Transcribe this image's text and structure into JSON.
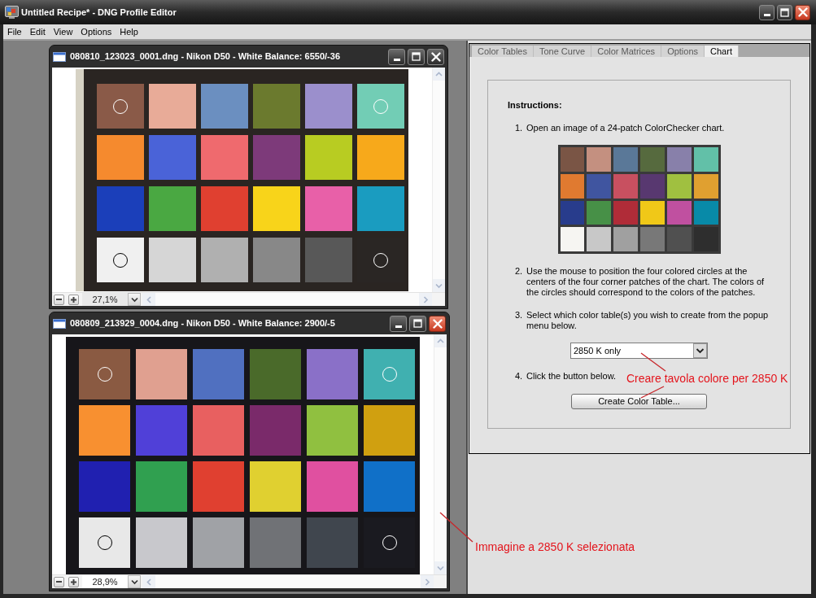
{
  "window": {
    "title": "Untitled Recipe* - DNG Profile Editor"
  },
  "menu": [
    "File",
    "Edit",
    "View",
    "Options",
    "Help"
  ],
  "documents": [
    {
      "title": "080810_123023_0001.dng - Nikon D50 - White Balance: 6550/-36",
      "active": false,
      "zoom": "27,1%"
    },
    {
      "title": "080809_213929_0004.dng - Nikon D50 - White Balance: 2900/-5",
      "active": true,
      "zoom": "28,9%"
    }
  ],
  "tabs": [
    {
      "label": "Color Tables",
      "selected": false
    },
    {
      "label": "Tone Curve",
      "selected": false
    },
    {
      "label": "Color Matrices",
      "selected": false
    },
    {
      "label": "Options",
      "selected": false
    },
    {
      "label": "Chart",
      "selected": true
    }
  ],
  "chart_tab": {
    "heading": "Instructions:",
    "content": [
      {
        "kind": "step",
        "number": "1.",
        "text": "Open an image of a 24-patch ColorChecker chart."
      },
      {
        "kind": "chart"
      },
      {
        "kind": "step",
        "number": "2.",
        "text": "Use the mouse to position the four colored circles at the centers of the four corner patches of the chart. The colors of the circles should correspond to the colors of the patches."
      },
      {
        "kind": "step",
        "number": "3.",
        "text": "Select which color table(s) you wish to create from the popup menu below."
      },
      {
        "kind": "popup",
        "value": "2850 K only"
      },
      {
        "kind": "step",
        "number": "4.",
        "text": "Click the button below."
      },
      {
        "kind": "button",
        "label": "Create Color Table..."
      }
    ]
  },
  "annotations": [
    "Creare tavola colore per 2850 K",
    "Immagine a 2850 K selezionata"
  ]
}
